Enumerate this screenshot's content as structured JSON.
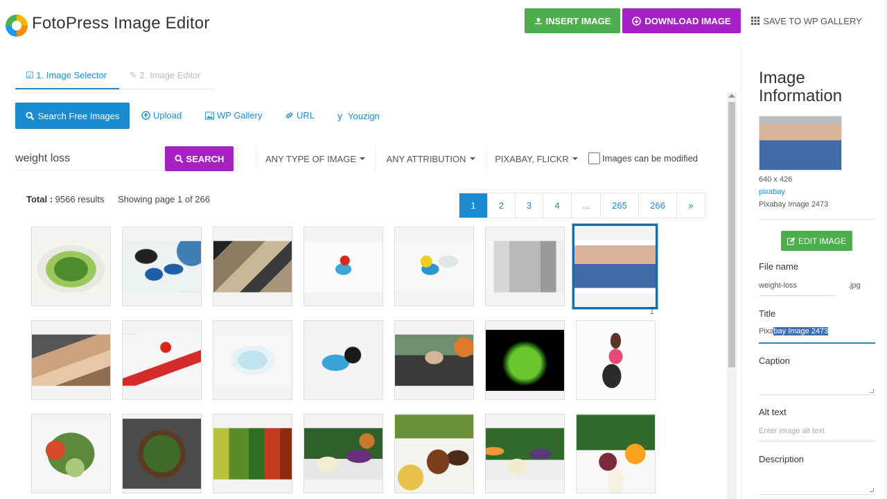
{
  "header": {
    "app_title": "FotoPress Image Editor",
    "insert_label": "INSERT IMAGE",
    "download_label": "DOWNLOAD IMAGE",
    "save_label": "SAVE TO WP GALLERY"
  },
  "steps": [
    {
      "label": "1. Image Selector",
      "active": true
    },
    {
      "label": "2. Image Editor",
      "active": false
    }
  ],
  "sources": {
    "search_free": "Search Free Images",
    "upload": "Upload",
    "wp_gallery": "WP Gallery",
    "url": "URL",
    "youzign": "Youzign"
  },
  "search": {
    "query": "weight loss",
    "button_label": "SEARCH",
    "filter_type": "ANY TYPE OF IMAGE",
    "filter_attribution": "ANY ATTRIBUTION",
    "filter_source": "PIXABAY, FLICKR",
    "modified_label": "Images can be modified",
    "modified_checked": false
  },
  "results": {
    "total_label": "Total :",
    "total_value": "9566 results",
    "showing": "Showing page 1 of 266",
    "pages": [
      "1",
      "2",
      "3",
      "4",
      "...",
      "265",
      "266",
      "»"
    ],
    "current_page": "1"
  },
  "grid": [
    {
      "name": "salad-plate",
      "selected": false
    },
    {
      "name": "blue-dumbbells-and-scale",
      "selected": false
    },
    {
      "name": "exercise-bike",
      "selected": false
    },
    {
      "name": "apple-with-tape-measure",
      "selected": false
    },
    {
      "name": "lemon-with-tape-and-water",
      "selected": false
    },
    {
      "name": "waist-measuring-tape",
      "selected": false
    },
    {
      "name": "loose-jeans-weight-loss",
      "selected": true
    },
    {
      "name": "sandwich-with-caliper",
      "selected": false
    },
    {
      "name": "apple-on-diet-notebook",
      "selected": false
    },
    {
      "name": "glass-scale-with-tape",
      "selected": false
    },
    {
      "name": "dumbbell-with-tape",
      "selected": false
    },
    {
      "name": "athlete-with-basketball",
      "selected": false
    },
    {
      "name": "green-apple",
      "selected": false
    },
    {
      "name": "woman-crouching-on-scale",
      "selected": false
    },
    {
      "name": "tomato-cucumber-salad",
      "selected": false
    },
    {
      "name": "salad-bowl",
      "selected": false
    },
    {
      "name": "peppers-and-tomatoes",
      "selected": false
    },
    {
      "name": "kale-cabbage-juice",
      "selected": false
    },
    {
      "name": "bottles-and-fruit",
      "selected": false
    },
    {
      "name": "orange-juice-and-greens",
      "selected": false
    },
    {
      "name": "greens-and-oranges",
      "selected": false
    }
  ],
  "info": {
    "panel_title": "Image Information",
    "dimensions": "640 x 426",
    "source": "pixabay",
    "image_name": "Pixabay Image 2473",
    "edit_label": "EDIT IMAGE",
    "file_name_label": "File name",
    "file_name_value": "weight-loss",
    "file_ext": ".jpg",
    "title_label": "Title",
    "title_plain": "Pixa",
    "title_selected": "bay Image 2473",
    "caption_label": "Caption",
    "alt_label": "Alt text",
    "alt_placeholder": "Enter image alt text",
    "description_label": "Description"
  },
  "colors": {
    "primary": "#1b8bd1",
    "green": "#4cae4c",
    "purple": "#a521c6",
    "selection": "#3a6fb6"
  }
}
